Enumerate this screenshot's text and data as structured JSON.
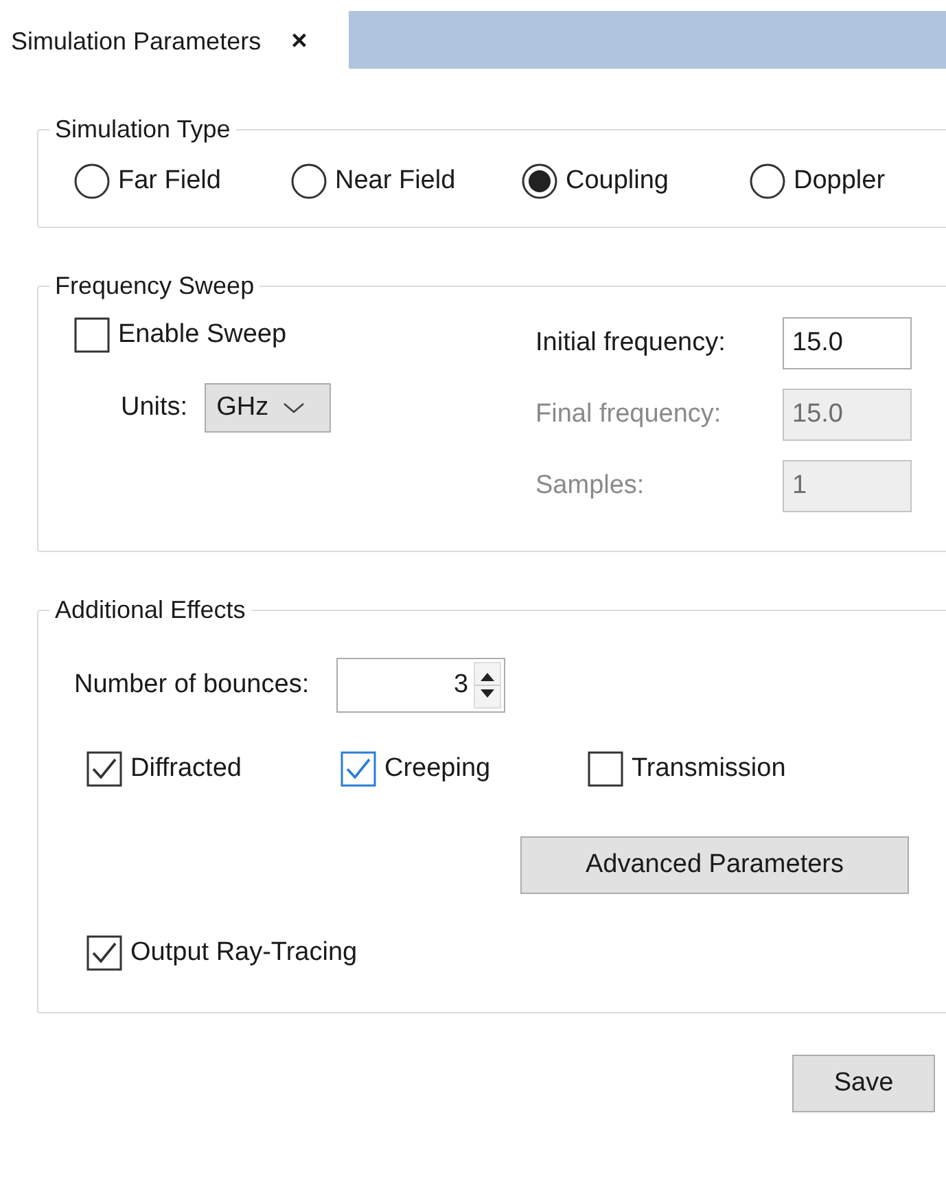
{
  "tab": {
    "label": "Simulation Parameters",
    "close": "×"
  },
  "simulation_type": {
    "title": "Simulation Type",
    "options": [
      {
        "label": "Far Field",
        "selected": false
      },
      {
        "label": "Near Field",
        "selected": false
      },
      {
        "label": "Coupling",
        "selected": true
      },
      {
        "label": "Doppler",
        "selected": false
      }
    ]
  },
  "frequency_sweep": {
    "title": "Frequency Sweep",
    "enable_sweep": {
      "label": "Enable Sweep",
      "checked": false
    },
    "units": {
      "label": "Units:",
      "value": "GHz"
    },
    "fields": [
      {
        "label": "Initial frequency:",
        "value": "15.0",
        "disabled": false
      },
      {
        "label": "Final frequency:",
        "value": "15.0",
        "disabled": true
      },
      {
        "label": "Samples:",
        "value": "1",
        "disabled": true
      }
    ]
  },
  "additional_effects": {
    "title": "Additional Effects",
    "bounces": {
      "label": "Number of bounces:",
      "value": "3"
    },
    "effects": [
      {
        "label": "Diffracted",
        "checked": true,
        "highlighted": false
      },
      {
        "label": "Creeping",
        "checked": true,
        "highlighted": true
      },
      {
        "label": "Transmission",
        "checked": false,
        "highlighted": false
      }
    ],
    "advanced_button": "Advanced Parameters",
    "output": {
      "label": "Output Ray-Tracing",
      "checked": true
    }
  },
  "save_button": "Save"
}
